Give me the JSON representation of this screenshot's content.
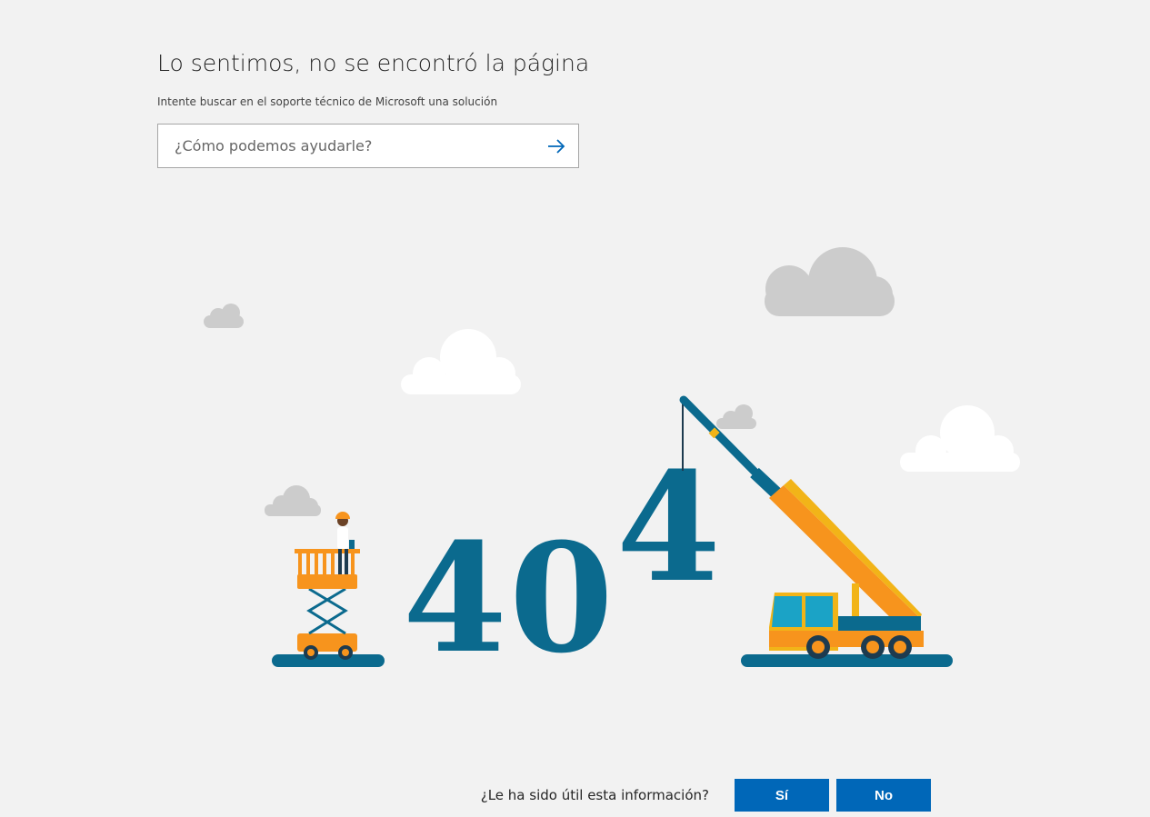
{
  "header": {
    "title": "Lo sentimos, no se encontró la página",
    "subtitle": "Intente buscar en el soporte técnico de Microsoft una solución"
  },
  "search": {
    "placeholder": "¿Cómo podemos ayudarle?",
    "value": "",
    "submit_icon": "arrow-right-icon"
  },
  "illustration": {
    "digits": [
      "4",
      "0",
      "4"
    ],
    "colors": {
      "digits": "#0b6a8e",
      "machine_orange": "#f7941d",
      "machine_yellow": "#f2b418",
      "ground": "#0b6a8e",
      "cloud_white": "#ffffff",
      "cloud_gray": "#cccccc"
    }
  },
  "feedback": {
    "question": "¿Le ha sido útil esta información?",
    "yes_label": "Sí",
    "no_label": "No",
    "button_color": "#0067b8"
  }
}
